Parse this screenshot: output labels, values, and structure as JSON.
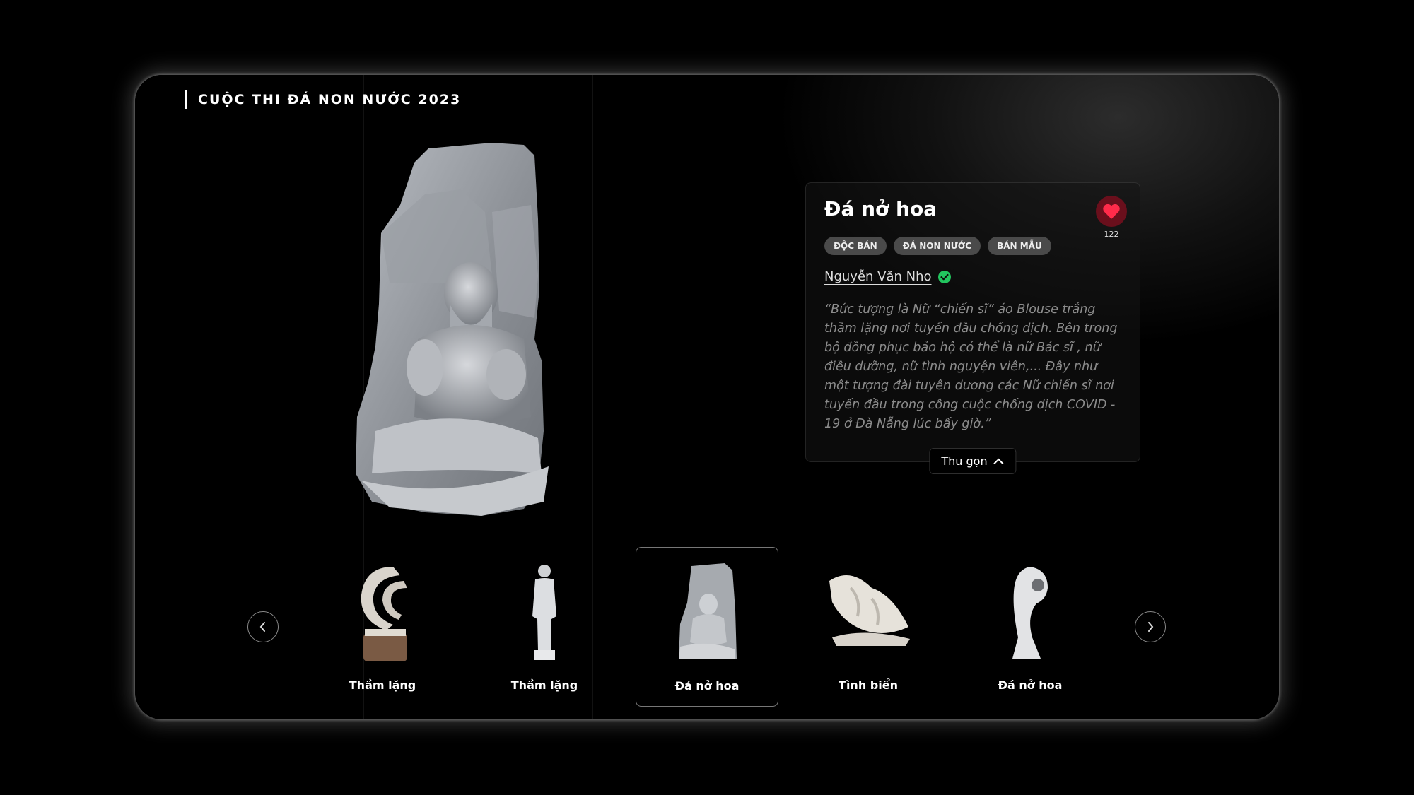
{
  "header": {
    "brand": "CUỘC THI ĐÁ NON NƯỚC 2023"
  },
  "artwork": {
    "title": "Đá nở hoa",
    "likes": "122",
    "tags": [
      "ĐỘC BẢN",
      "ĐÁ NON NƯỚC",
      "BẢN MẪU"
    ],
    "author": "Nguyễn Văn Nho",
    "description": "“Bức tượng là Nữ “chiến sĩ” áo Blouse trắng thầm lặng nơi tuyến đầu chống dịch. Bên trong bộ đồng phục bảo hộ có thể là nữ Bác sĩ , nữ điều dưỡng, nữ tình nguyện viên,... Đây như một tượng đài tuyên dương các Nữ chiến sĩ nơi tuyến đầu trong công cuộc chống dịch COVID - 19 ở Đà Nẵng lúc bấy giờ.”",
    "collapse_label": "Thu gọn"
  },
  "carousel": {
    "items": [
      {
        "label": "Thầm lặng",
        "icon": "wave-sculpture-icon"
      },
      {
        "label": "Thầm lặng",
        "icon": "standing-figure-sculpture-icon"
      },
      {
        "label": "Đá nở hoa",
        "icon": "seated-figure-relief-icon",
        "active": true
      },
      {
        "label": "Tình biển",
        "icon": "fish-sculpture-icon"
      },
      {
        "label": "Đá nở hoa",
        "icon": "abstract-curve-sculpture-icon"
      }
    ]
  },
  "colors": {
    "accent": "#ff2b4a",
    "verified": "#22c55e",
    "tag_bg": "#4a4a4a"
  }
}
